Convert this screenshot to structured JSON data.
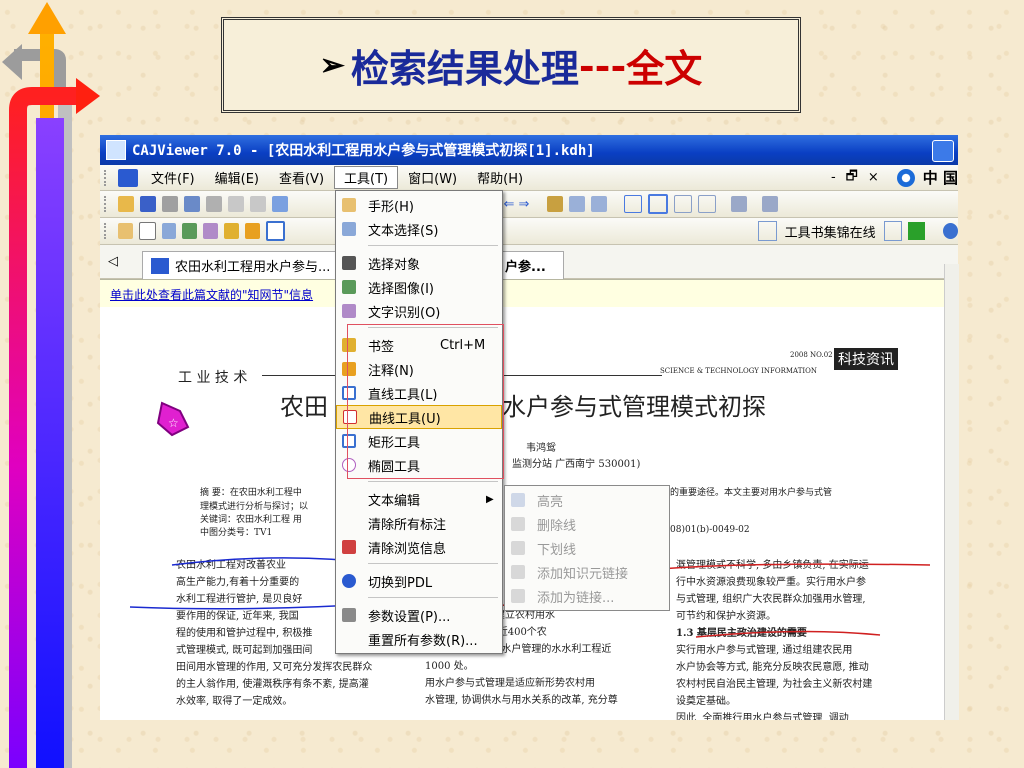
{
  "slide": {
    "bullet": "➢",
    "title": "检索结果处理",
    "dashes": "---",
    "title_suffix": "全文",
    "colors": {
      "title": "#1a2a9a",
      "accent": "#cc0000"
    }
  },
  "window": {
    "title": "CAJViewer 7.0 - [农田水利工程用水户参与式管理模式初探[1].kdh]",
    "menubar": {
      "items": [
        "文件(F)",
        "编辑(E)",
        "查看(V)",
        "工具(T)",
        "窗口(W)",
        "帮助(H)"
      ],
      "right": [
        "-",
        "🗗",
        "×"
      ],
      "china": "中 国"
    },
    "toolbar2_select": "工具书集锦在线",
    "tab": {
      "label": "农田水利工程用水户参与...",
      "tail": "户参...",
      "back": "◁"
    },
    "infobar": "单击此处查看此篇文献的\"知网节\"信息"
  },
  "menu": {
    "items": [
      {
        "label": "手形(H)",
        "icon": "hand-icon"
      },
      {
        "label": "文本选择(S)",
        "icon": "text-select-icon"
      },
      {
        "label": "选择对象",
        "icon": "pointer-icon"
      },
      {
        "label": "选择图像(I)",
        "icon": "image-select-icon"
      },
      {
        "label": "文字识别(O)",
        "icon": "ocr-icon"
      },
      {
        "label": "书签",
        "shortcut": "Ctrl+M",
        "icon": "bookmark-icon"
      },
      {
        "label": "注释(N)",
        "icon": "note-icon"
      },
      {
        "label": "直线工具(L)",
        "icon": "line-icon"
      },
      {
        "label": "曲线工具(U)",
        "icon": "curve-icon"
      },
      {
        "label": "矩形工具",
        "icon": "rectangle-icon"
      },
      {
        "label": "椭圆工具",
        "icon": "ellipse-icon"
      },
      {
        "label": "文本编辑",
        "icon": "none",
        "arrow": "▶"
      },
      {
        "label": "清除所有标注",
        "icon": "none"
      },
      {
        "label": "清除浏览信息",
        "icon": "clear-history-icon"
      },
      {
        "label": "切换到PDL",
        "icon": "switch-icon"
      },
      {
        "label": "参数设置(P)...",
        "icon": "settings-icon"
      },
      {
        "label": "重置所有参数(R)...",
        "icon": "none"
      }
    ],
    "submenu": [
      "高亮",
      "删除线",
      "下划线",
      "添加知识元链接",
      "添加为链接..."
    ]
  },
  "document": {
    "category": "工 业 技 术",
    "journal_tag": "SCIENCE & TECHNOLOGY INFORMATION",
    "year_issue": "2008 NO.02",
    "journal_name": "科技资讯",
    "title_left": "农田",
    "title_right": "水户参与式管理模式初探",
    "author": "韦鸿鸳",
    "affiliation": "监测分站   广西南宁  530001)",
    "abstract_label": "摘    要：在农田水利工程中",
    "abstract_l2": "理模式进行分析与探讨；以",
    "keywords": "关键词：农田水利工程    用",
    "clc": "中图分类号：TV1",
    "abstract_r1": "的重要途径。本文主要对用水户参与式管",
    "doc_id": "08)01(b)-0049-02",
    "col1": [
      "农田水利工程对改善农业",
      "高生产能力,有着十分重要的",
      "水利工程进行管护, 是贝良好",
      "要作用的保证, 近年来, 我国",
      "程的使用和管护过程中, 积极推",
      "式管理模式, 既可起到加强田间",
      "田间用水管理的作用, 又可充分发挥农民群众",
      "的主人翁作用, 使灌溉秩序有条不紊, 提高灌",
      "水效率, 取得了一定成效。"
    ],
    "col2": [
      "和指导全县农民建立农村用水",
      "06年已经建立了近400个农",
      "村用水户协会, 用水户管理的水水利工程近",
      "1000 处。",
      "    用水户参与式管理是适应新形势农村用",
      "水管理, 协调供水与用水关系的改革, 充分尊"
    ],
    "col3": [
      "溉管理模式不科学, 多由乡镇负责, 在实际运",
      "行中水资源浪费现象较严重。实行用水户参",
      "与式管理, 组织广大农民群众加强用水管理,",
      "可节约和保护水资源。",
      "1.3  基层民主政治建设的需要",
      "    实行用水户参与式管理, 通过组建农民用",
      "水户协会等方式, 能充分反映农民意愿, 推动",
      "农村村民自治民主管理, 为社会主义新农村建",
      "设奠定基础。",
      "    因此, 全面推行用水户参与式管理, 调动"
    ]
  }
}
